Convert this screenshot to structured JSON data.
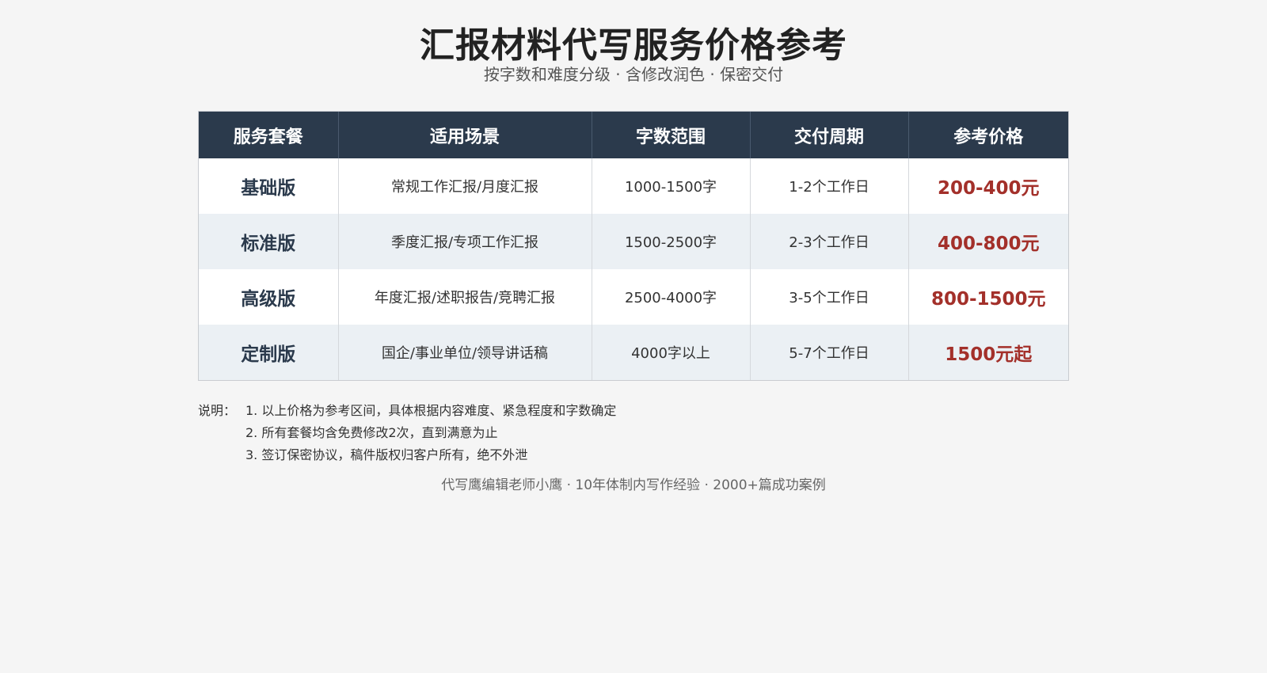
{
  "header": {
    "title": "汇报材料代写服务价格参考",
    "subtitle": "按字数和难度分级 · 含修改润色 · 保密交付"
  },
  "table": {
    "columns": [
      "服务套餐",
      "适用场景",
      "字数范围",
      "交付周期",
      "参考价格"
    ],
    "rows": [
      {
        "package": "基础版",
        "scene": "常规工作汇报/月度汇报",
        "words": "1000-1500字",
        "period": "1-2个工作日",
        "price": "200-400元"
      },
      {
        "package": "标准版",
        "scene": "季度汇报/专项工作汇报",
        "words": "1500-2500字",
        "period": "2-3个工作日",
        "price": "400-800元"
      },
      {
        "package": "高级版",
        "scene": "年度汇报/述职报告/竞聘汇报",
        "words": "2500-4000字",
        "period": "3-5个工作日",
        "price": "800-1500元"
      },
      {
        "package": "定制版",
        "scene": "国企/事业单位/领导讲话稿",
        "words": "4000字以上",
        "period": "5-7个工作日",
        "price": "1500元起"
      }
    ]
  },
  "notes": {
    "label": "说明：",
    "items": [
      "1. 以上价格为参考区间，具体根据内容难度、紧急程度和字数确定",
      "2. 所有套餐均含免费修改2次，直到满意为止",
      "3. 签订保密协议，稿件版权归客户所有，绝不外泄"
    ]
  },
  "footer": {
    "text": "代写鹰编辑老师小鹰 · 10年体制内写作经验 · 2000+篇成功案例"
  },
  "colors": {
    "header_bg": "#2b3a4c",
    "price_red": "#a3302a",
    "stripe": "#ebf0f4"
  }
}
